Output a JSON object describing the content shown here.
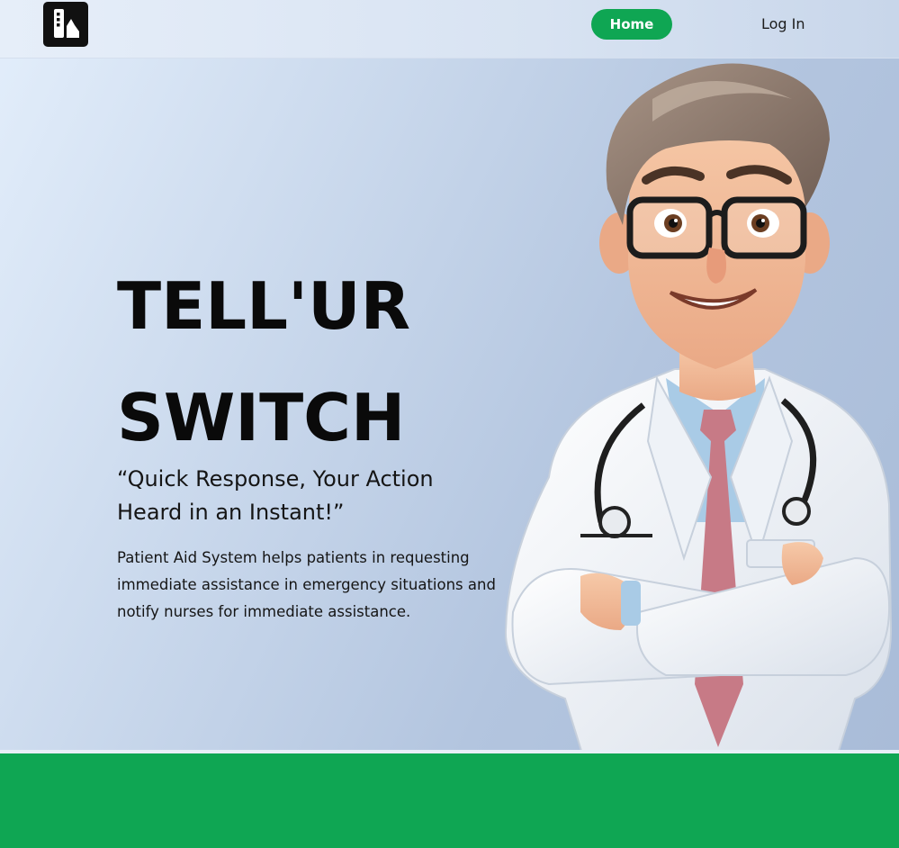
{
  "nav": {
    "logo_icon": "app-logo-icon",
    "home_label": "Home",
    "login_label": "Log In"
  },
  "hero": {
    "title_line1": "TELL'UR",
    "title_line2": "SWITCH",
    "tagline": "“Quick Response, Your Action Heard in an Instant!”",
    "description": "Patient Aid System helps patients in requesting immediate assistance in emergency situations and notify nurses for immediate assistance.",
    "illustration": "doctor-illustration"
  },
  "colors": {
    "accent_green": "#0fa653",
    "text_dark": "#0a0a0a",
    "hero_bg_light": "#e3eefb",
    "hero_bg_dark": "#a9bcd8"
  }
}
